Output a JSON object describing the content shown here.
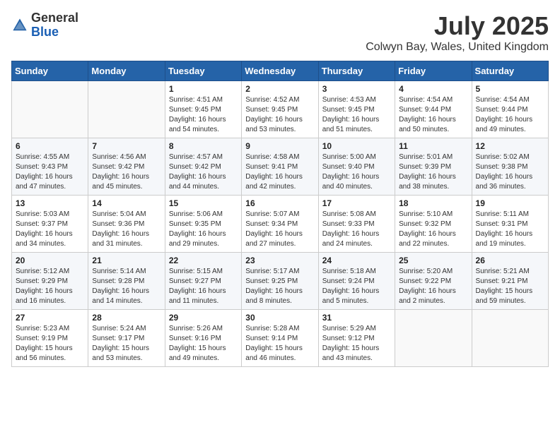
{
  "header": {
    "logo_general": "General",
    "logo_blue": "Blue",
    "month": "July 2025",
    "location": "Colwyn Bay, Wales, United Kingdom"
  },
  "days_of_week": [
    "Sunday",
    "Monday",
    "Tuesday",
    "Wednesday",
    "Thursday",
    "Friday",
    "Saturday"
  ],
  "weeks": [
    [
      {
        "day": "",
        "info": ""
      },
      {
        "day": "",
        "info": ""
      },
      {
        "day": "1",
        "info": "Sunrise: 4:51 AM\nSunset: 9:45 PM\nDaylight: 16 hours and 54 minutes."
      },
      {
        "day": "2",
        "info": "Sunrise: 4:52 AM\nSunset: 9:45 PM\nDaylight: 16 hours and 53 minutes."
      },
      {
        "day": "3",
        "info": "Sunrise: 4:53 AM\nSunset: 9:45 PM\nDaylight: 16 hours and 51 minutes."
      },
      {
        "day": "4",
        "info": "Sunrise: 4:54 AM\nSunset: 9:44 PM\nDaylight: 16 hours and 50 minutes."
      },
      {
        "day": "5",
        "info": "Sunrise: 4:54 AM\nSunset: 9:44 PM\nDaylight: 16 hours and 49 minutes."
      }
    ],
    [
      {
        "day": "6",
        "info": "Sunrise: 4:55 AM\nSunset: 9:43 PM\nDaylight: 16 hours and 47 minutes."
      },
      {
        "day": "7",
        "info": "Sunrise: 4:56 AM\nSunset: 9:42 PM\nDaylight: 16 hours and 45 minutes."
      },
      {
        "day": "8",
        "info": "Sunrise: 4:57 AM\nSunset: 9:42 PM\nDaylight: 16 hours and 44 minutes."
      },
      {
        "day": "9",
        "info": "Sunrise: 4:58 AM\nSunset: 9:41 PM\nDaylight: 16 hours and 42 minutes."
      },
      {
        "day": "10",
        "info": "Sunrise: 5:00 AM\nSunset: 9:40 PM\nDaylight: 16 hours and 40 minutes."
      },
      {
        "day": "11",
        "info": "Sunrise: 5:01 AM\nSunset: 9:39 PM\nDaylight: 16 hours and 38 minutes."
      },
      {
        "day": "12",
        "info": "Sunrise: 5:02 AM\nSunset: 9:38 PM\nDaylight: 16 hours and 36 minutes."
      }
    ],
    [
      {
        "day": "13",
        "info": "Sunrise: 5:03 AM\nSunset: 9:37 PM\nDaylight: 16 hours and 34 minutes."
      },
      {
        "day": "14",
        "info": "Sunrise: 5:04 AM\nSunset: 9:36 PM\nDaylight: 16 hours and 31 minutes."
      },
      {
        "day": "15",
        "info": "Sunrise: 5:06 AM\nSunset: 9:35 PM\nDaylight: 16 hours and 29 minutes."
      },
      {
        "day": "16",
        "info": "Sunrise: 5:07 AM\nSunset: 9:34 PM\nDaylight: 16 hours and 27 minutes."
      },
      {
        "day": "17",
        "info": "Sunrise: 5:08 AM\nSunset: 9:33 PM\nDaylight: 16 hours and 24 minutes."
      },
      {
        "day": "18",
        "info": "Sunrise: 5:10 AM\nSunset: 9:32 PM\nDaylight: 16 hours and 22 minutes."
      },
      {
        "day": "19",
        "info": "Sunrise: 5:11 AM\nSunset: 9:31 PM\nDaylight: 16 hours and 19 minutes."
      }
    ],
    [
      {
        "day": "20",
        "info": "Sunrise: 5:12 AM\nSunset: 9:29 PM\nDaylight: 16 hours and 16 minutes."
      },
      {
        "day": "21",
        "info": "Sunrise: 5:14 AM\nSunset: 9:28 PM\nDaylight: 16 hours and 14 minutes."
      },
      {
        "day": "22",
        "info": "Sunrise: 5:15 AM\nSunset: 9:27 PM\nDaylight: 16 hours and 11 minutes."
      },
      {
        "day": "23",
        "info": "Sunrise: 5:17 AM\nSunset: 9:25 PM\nDaylight: 16 hours and 8 minutes."
      },
      {
        "day": "24",
        "info": "Sunrise: 5:18 AM\nSunset: 9:24 PM\nDaylight: 16 hours and 5 minutes."
      },
      {
        "day": "25",
        "info": "Sunrise: 5:20 AM\nSunset: 9:22 PM\nDaylight: 16 hours and 2 minutes."
      },
      {
        "day": "26",
        "info": "Sunrise: 5:21 AM\nSunset: 9:21 PM\nDaylight: 15 hours and 59 minutes."
      }
    ],
    [
      {
        "day": "27",
        "info": "Sunrise: 5:23 AM\nSunset: 9:19 PM\nDaylight: 15 hours and 56 minutes."
      },
      {
        "day": "28",
        "info": "Sunrise: 5:24 AM\nSunset: 9:17 PM\nDaylight: 15 hours and 53 minutes."
      },
      {
        "day": "29",
        "info": "Sunrise: 5:26 AM\nSunset: 9:16 PM\nDaylight: 15 hours and 49 minutes."
      },
      {
        "day": "30",
        "info": "Sunrise: 5:28 AM\nSunset: 9:14 PM\nDaylight: 15 hours and 46 minutes."
      },
      {
        "day": "31",
        "info": "Sunrise: 5:29 AM\nSunset: 9:12 PM\nDaylight: 15 hours and 43 minutes."
      },
      {
        "day": "",
        "info": ""
      },
      {
        "day": "",
        "info": ""
      }
    ]
  ]
}
